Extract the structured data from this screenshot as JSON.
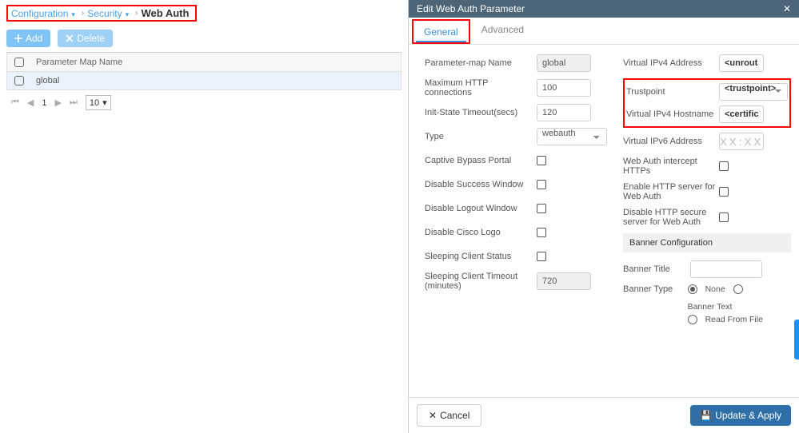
{
  "breadcrumb": {
    "configuration": "Configuration",
    "security": "Security",
    "current": "Web Auth"
  },
  "toolbar": {
    "add": "Add",
    "delete": "Delete"
  },
  "table": {
    "header": "Parameter Map Name",
    "rows": [
      {
        "name": "global"
      }
    ]
  },
  "pager": {
    "page": "1",
    "size": "10"
  },
  "modal": {
    "title": "Edit Web Auth Parameter",
    "close": "✕",
    "tabs": {
      "general": "General",
      "advanced": "Advanced"
    },
    "left": {
      "param_map_name_label": "Parameter-map Name",
      "param_map_name_value": "global",
      "max_http_label": "Maximum HTTP connections",
      "max_http_value": "100",
      "init_state_label": "Init-State Timeout(secs)",
      "init_state_value": "120",
      "type_label": "Type",
      "type_value": "webauth",
      "captive_label": "Captive Bypass Portal",
      "disable_success_label": "Disable Success Window",
      "disable_logout_label": "Disable Logout Window",
      "disable_cisco_label": "Disable Cisco Logo",
      "sleep_status_label": "Sleeping Client Status",
      "sleep_timeout_label": "Sleeping Client Timeout (minutes)",
      "sleep_timeout_value": "720"
    },
    "right": {
      "vip4addr_label": "Virtual IPv4 Address",
      "vip4addr_value": "<unroutable-ip>",
      "trustpoint_label": "Trustpoint",
      "trustpoint_value": "<trustpoint>",
      "vip4host_label": "Virtual IPv4 Hostname",
      "vip4host_value": "<certificate-CN>",
      "vip6addr_label": "Virtual IPv6 Address",
      "vip6addr_value": "XX:XX::X",
      "intercept_label": "Web Auth intercept HTTPs",
      "enable_http_label": "Enable HTTP server for Web Auth",
      "disable_https_label": "Disable HTTP secure server for Web Auth",
      "banner_config_header": "Banner Configuration",
      "banner_title_label": "Banner Title",
      "banner_title_value": "",
      "banner_type_label": "Banner Type",
      "banner_type_options": {
        "none": "None",
        "text": "Banner Text",
        "file": "Read From File"
      }
    },
    "footer": {
      "cancel": "Cancel",
      "apply": "Update & Apply"
    }
  }
}
